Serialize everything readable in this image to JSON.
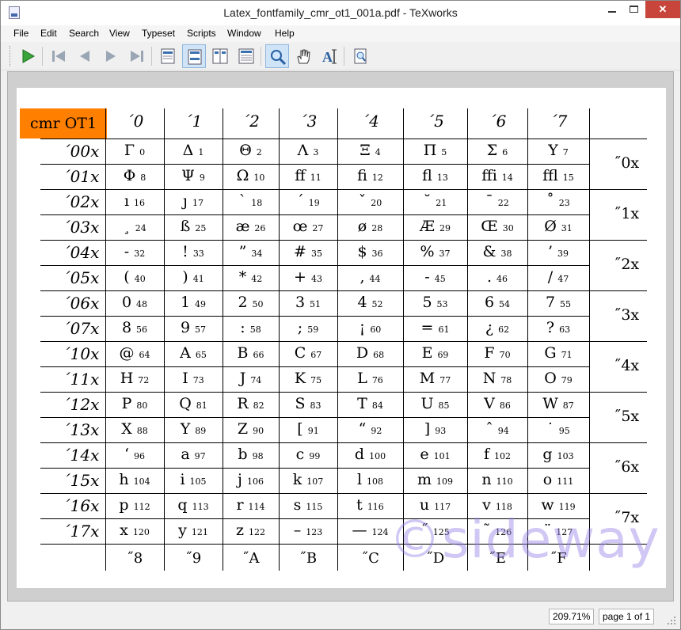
{
  "window": {
    "title": "Latex_fontfamily_cmr_ot1_001a.pdf - TeXworks",
    "min_label": "",
    "max_label": "",
    "close_label": "✕"
  },
  "menu": [
    "File",
    "Edit",
    "Search",
    "View",
    "Typeset",
    "Scripts",
    "Window",
    "Help"
  ],
  "toolbar": {
    "buttons": [
      {
        "name": "typeset-icon",
        "active": false
      },
      {
        "name": "first-page-icon",
        "active": false
      },
      {
        "name": "previous-page-icon",
        "active": false
      },
      {
        "name": "next-page-icon",
        "active": false
      },
      {
        "name": "last-page-icon",
        "active": false
      },
      {
        "name": "single-page-icon",
        "active": false
      },
      {
        "name": "continuous-page-icon",
        "active": true
      },
      {
        "name": "two-pages-icon",
        "active": false
      },
      {
        "name": "continuous-two-pages-icon",
        "active": false
      },
      {
        "name": "magnify-icon",
        "active": true
      },
      {
        "name": "hand-scroll-icon",
        "active": false
      },
      {
        "name": "select-text-icon",
        "active": false
      },
      {
        "name": "print-preview-icon",
        "active": false
      }
    ]
  },
  "table": {
    "corner_label": "cmr OT1",
    "col_headers": [
      "´0",
      "´1",
      "´2",
      "´3",
      "´4",
      "´5",
      "´6",
      "´7"
    ],
    "row_headers": [
      "´00x",
      "´01x",
      "´02x",
      "´03x",
      "´04x",
      "´05x",
      "´06x",
      "´07x",
      "´10x",
      "´11x",
      "´12x",
      "´13x",
      "´14x",
      "´15x",
      "´16x",
      "´17x"
    ],
    "group_headers": [
      "˝0x",
      "˝1x",
      "˝2x",
      "˝3x",
      "˝4x",
      "˝5x",
      "˝6x",
      "˝7x"
    ],
    "bottom_headers": [
      "˝8",
      "˝9",
      "˝A",
      "˝B",
      "˝C",
      "˝D",
      "˝E",
      "˝F"
    ],
    "rows": [
      [
        {
          "g": "Γ",
          "n": "0"
        },
        {
          "g": "Δ",
          "n": "1"
        },
        {
          "g": "Θ",
          "n": "2"
        },
        {
          "g": "Λ",
          "n": "3"
        },
        {
          "g": "Ξ",
          "n": "4"
        },
        {
          "g": "Π",
          "n": "5"
        },
        {
          "g": "Σ",
          "n": "6"
        },
        {
          "g": "Υ",
          "n": "7"
        }
      ],
      [
        {
          "g": "Φ",
          "n": "8"
        },
        {
          "g": "Ψ",
          "n": "9"
        },
        {
          "g": "Ω",
          "n": "10"
        },
        {
          "g": "ff",
          "n": "11"
        },
        {
          "g": "fi",
          "n": "12"
        },
        {
          "g": "fl",
          "n": "13"
        },
        {
          "g": "ffi",
          "n": "14"
        },
        {
          "g": "ffl",
          "n": "15"
        }
      ],
      [
        {
          "g": "ı",
          "n": "16"
        },
        {
          "g": "ȷ",
          "n": "17"
        },
        {
          "g": "`",
          "n": "18"
        },
        {
          "g": "´",
          "n": "19"
        },
        {
          "g": "ˇ",
          "n": "20"
        },
        {
          "g": "˘",
          "n": "21"
        },
        {
          "g": "¯",
          "n": "22"
        },
        {
          "g": "˚",
          "n": "23"
        }
      ],
      [
        {
          "g": "¸",
          "n": "24"
        },
        {
          "g": "ß",
          "n": "25"
        },
        {
          "g": "æ",
          "n": "26"
        },
        {
          "g": "œ",
          "n": "27"
        },
        {
          "g": "ø",
          "n": "28"
        },
        {
          "g": "Æ",
          "n": "29"
        },
        {
          "g": "Œ",
          "n": "30"
        },
        {
          "g": "Ø",
          "n": "31"
        }
      ],
      [
        {
          "g": "-",
          "n": "32"
        },
        {
          "g": "!",
          "n": "33"
        },
        {
          "g": "”",
          "n": "34"
        },
        {
          "g": "#",
          "n": "35"
        },
        {
          "g": "$",
          "n": "36"
        },
        {
          "g": "%",
          "n": "37"
        },
        {
          "g": "&",
          "n": "38"
        },
        {
          "g": "’",
          "n": "39"
        }
      ],
      [
        {
          "g": "(",
          "n": "40"
        },
        {
          "g": ")",
          "n": "41"
        },
        {
          "g": "*",
          "n": "42"
        },
        {
          "g": "+",
          "n": "43"
        },
        {
          "g": ",",
          "n": "44"
        },
        {
          "g": "-",
          "n": "45"
        },
        {
          "g": ".",
          "n": "46"
        },
        {
          "g": "/",
          "n": "47"
        }
      ],
      [
        {
          "g": "0",
          "n": "48"
        },
        {
          "g": "1",
          "n": "49"
        },
        {
          "g": "2",
          "n": "50"
        },
        {
          "g": "3",
          "n": "51"
        },
        {
          "g": "4",
          "n": "52"
        },
        {
          "g": "5",
          "n": "53"
        },
        {
          "g": "6",
          "n": "54"
        },
        {
          "g": "7",
          "n": "55"
        }
      ],
      [
        {
          "g": "8",
          "n": "56"
        },
        {
          "g": "9",
          "n": "57"
        },
        {
          "g": ":",
          "n": "58"
        },
        {
          "g": ";",
          "n": "59"
        },
        {
          "g": "¡",
          "n": "60"
        },
        {
          "g": "=",
          "n": "61"
        },
        {
          "g": "¿",
          "n": "62"
        },
        {
          "g": "?",
          "n": "63"
        }
      ],
      [
        {
          "g": "@",
          "n": "64"
        },
        {
          "g": "A",
          "n": "65"
        },
        {
          "g": "B",
          "n": "66"
        },
        {
          "g": "C",
          "n": "67"
        },
        {
          "g": "D",
          "n": "68"
        },
        {
          "g": "E",
          "n": "69"
        },
        {
          "g": "F",
          "n": "70"
        },
        {
          "g": "G",
          "n": "71"
        }
      ],
      [
        {
          "g": "H",
          "n": "72"
        },
        {
          "g": "I",
          "n": "73"
        },
        {
          "g": "J",
          "n": "74"
        },
        {
          "g": "K",
          "n": "75"
        },
        {
          "g": "L",
          "n": "76"
        },
        {
          "g": "M",
          "n": "77"
        },
        {
          "g": "N",
          "n": "78"
        },
        {
          "g": "O",
          "n": "79"
        }
      ],
      [
        {
          "g": "P",
          "n": "80"
        },
        {
          "g": "Q",
          "n": "81"
        },
        {
          "g": "R",
          "n": "82"
        },
        {
          "g": "S",
          "n": "83"
        },
        {
          "g": "T",
          "n": "84"
        },
        {
          "g": "U",
          "n": "85"
        },
        {
          "g": "V",
          "n": "86"
        },
        {
          "g": "W",
          "n": "87"
        }
      ],
      [
        {
          "g": "X",
          "n": "88"
        },
        {
          "g": "Y",
          "n": "89"
        },
        {
          "g": "Z",
          "n": "90"
        },
        {
          "g": "[",
          "n": "91"
        },
        {
          "g": "“",
          "n": "92"
        },
        {
          "g": "]",
          "n": "93"
        },
        {
          "g": "ˆ",
          "n": "94"
        },
        {
          "g": "˙",
          "n": "95"
        }
      ],
      [
        {
          "g": "‘",
          "n": "96"
        },
        {
          "g": "a",
          "n": "97"
        },
        {
          "g": "b",
          "n": "98"
        },
        {
          "g": "c",
          "n": "99"
        },
        {
          "g": "d",
          "n": "100"
        },
        {
          "g": "e",
          "n": "101"
        },
        {
          "g": "f",
          "n": "102"
        },
        {
          "g": "g",
          "n": "103"
        }
      ],
      [
        {
          "g": "h",
          "n": "104"
        },
        {
          "g": "i",
          "n": "105"
        },
        {
          "g": "j",
          "n": "106"
        },
        {
          "g": "k",
          "n": "107"
        },
        {
          "g": "l",
          "n": "108"
        },
        {
          "g": "m",
          "n": "109"
        },
        {
          "g": "n",
          "n": "110"
        },
        {
          "g": "o",
          "n": "111"
        }
      ],
      [
        {
          "g": "p",
          "n": "112"
        },
        {
          "g": "q",
          "n": "113"
        },
        {
          "g": "r",
          "n": "114"
        },
        {
          "g": "s",
          "n": "115"
        },
        {
          "g": "t",
          "n": "116"
        },
        {
          "g": "u",
          "n": "117"
        },
        {
          "g": "v",
          "n": "118"
        },
        {
          "g": "w",
          "n": "119"
        }
      ],
      [
        {
          "g": "x",
          "n": "120"
        },
        {
          "g": "y",
          "n": "121"
        },
        {
          "g": "z",
          "n": "122"
        },
        {
          "g": "–",
          "n": "123"
        },
        {
          "g": "—",
          "n": "124"
        },
        {
          "g": "˝",
          "n": "125"
        },
        {
          "g": "˜",
          "n": "126"
        },
        {
          "g": "¨",
          "n": "127"
        }
      ]
    ],
    "corner_color": "#ff7f00"
  },
  "watermark": "©sideway",
  "status": {
    "zoom": "209.71%",
    "page": "page 1 of 1"
  }
}
